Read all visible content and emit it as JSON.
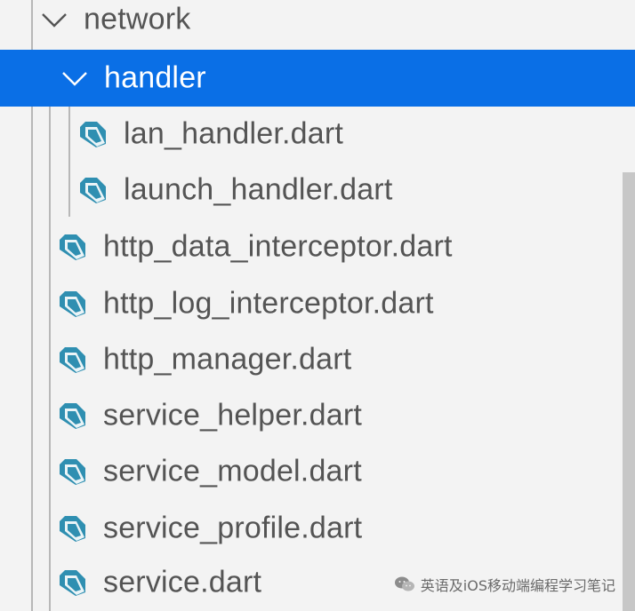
{
  "explorer": {
    "folders": {
      "network": "network",
      "handler": "handler"
    },
    "handler_files": [
      "lan_handler.dart",
      "launch_handler.dart"
    ],
    "network_files": [
      "http_data_interceptor.dart",
      "http_log_interceptor.dart",
      "http_manager.dart",
      "service_helper.dart",
      "service_model.dart",
      "service_profile.dart",
      "service.dart"
    ]
  },
  "watermark": {
    "text": "英语及iOS移动端编程学习笔记"
  },
  "colors": {
    "selection": "#0a6fe6",
    "dart_icon": "#2f8fb1",
    "text": "#545454",
    "background": "#f3f3f3"
  },
  "icons": {
    "folder_toggle": "chevron-down-icon",
    "dart_file": "dart-file-icon",
    "watermark": "wechat-icon"
  }
}
